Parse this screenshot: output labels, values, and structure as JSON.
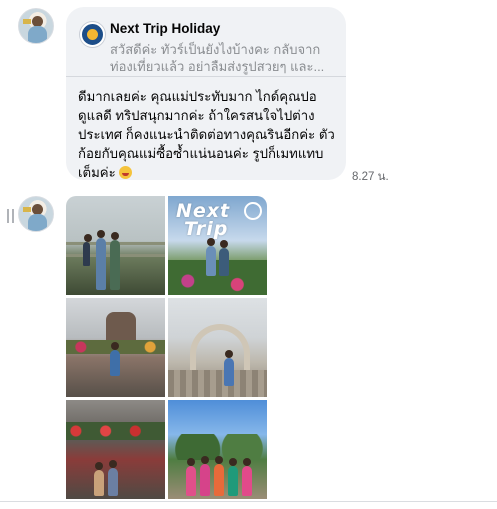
{
  "thread": {
    "first_message": {
      "reply": {
        "title": "Next Trip Holiday",
        "preview": "สวัสดีค่ะ ทัวร์เป็นยังไงบ้างคะ กลับจากท่องเที่ยวแล้ว อย่าลืมส่งรูปสวยๆ และ..."
      },
      "text": "ดีมากเลยค่ะ คุณแม่ประทับมาก ไกด์คุณปอดูแลดี ทริปสนุกมากค่ะ ถ้าใครสนใจไปต่างประเทศ ก็คงแนะนำติดต่อทางคุณรินอีกค่ะ ตัวก้อยกับคุณแม่ซื้อซ้ำแน่นอนค่ะ รูปก็เมทแทบเต็มค่ะ",
      "emoji": "grinning-face-icon",
      "time": "8.27 น."
    },
    "photo_message": {
      "overlay_logo_line1": "Next",
      "overlay_logo_line2": "Trip",
      "photo_count": 6
    }
  },
  "colors": {
    "bubble": "#f0f2f5",
    "text": "#050505",
    "muted": "#65676b",
    "reply_logo": "#1d4e89"
  }
}
